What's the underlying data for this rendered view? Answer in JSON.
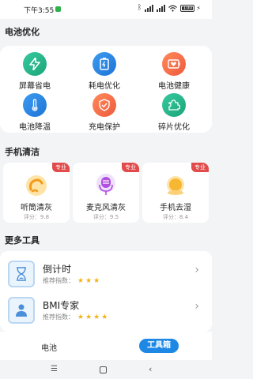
{
  "status": {
    "time": "下午3:55",
    "battery": "100"
  },
  "sections": {
    "battery": "电池优化",
    "clean": "手机清洁",
    "tools": "更多工具"
  },
  "battery_items": [
    {
      "label": "屏幕省电",
      "icon": "lightning-icon",
      "color": "#27b98c"
    },
    {
      "label": "耗电优化",
      "icon": "battery-icon",
      "color": "#2d86e0"
    },
    {
      "label": "电池健康",
      "icon": "heart-battery-icon",
      "color": "#f06a4a"
    },
    {
      "label": "电池降温",
      "icon": "thermometer-icon",
      "color": "#2d86e0"
    },
    {
      "label": "充电保护",
      "icon": "shield-check-icon",
      "color": "#f06a4a"
    },
    {
      "label": "碎片优化",
      "icon": "puzzle-icon",
      "color": "#27b98c"
    }
  ],
  "clean_items": [
    {
      "name": "听筒清灰",
      "score": "评分：9.8",
      "tag": "专业"
    },
    {
      "name": "麦克风清灰",
      "score": "评分：9.5",
      "tag": "专业"
    },
    {
      "name": "手机去湿",
      "score": "评分：8.4",
      "tag": "专业"
    }
  ],
  "tools": [
    {
      "name": "倒计时",
      "rate_label": "推荐指数：",
      "stars": "★★★"
    },
    {
      "name": "BMI专家",
      "rate_label": "推荐指数：",
      "stars": "★★★★"
    }
  ],
  "tabs": {
    "battery": "电池",
    "tools": "工具箱"
  },
  "nav": {
    "menu": "☰",
    "back": "‹"
  }
}
